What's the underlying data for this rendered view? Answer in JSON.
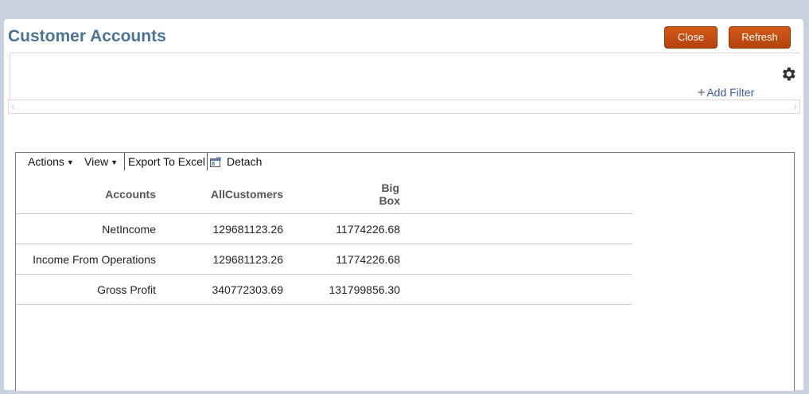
{
  "page": {
    "title": "Customer Accounts"
  },
  "buttons": {
    "close": "Close",
    "refresh": "Refresh"
  },
  "filter": {
    "add_label": "Add Filter"
  },
  "toolbar": {
    "actions": "Actions",
    "view": "View",
    "export": "Export To Excel",
    "detach": "Detach"
  },
  "table": {
    "headers": [
      "Accounts",
      "AllCustomers",
      "Big",
      "Box"
    ],
    "rows": [
      [
        "NetIncome",
        "129681123.26",
        "11774226.68"
      ],
      [
        "Income From Operations",
        "129681123.26",
        "11774226.68"
      ],
      [
        "Gross Profit",
        "340772303.69",
        "131799856.30"
      ]
    ]
  },
  "colors": {
    "title": "#4c7396",
    "button": "#c04a10",
    "link": "#3b5ea0"
  }
}
